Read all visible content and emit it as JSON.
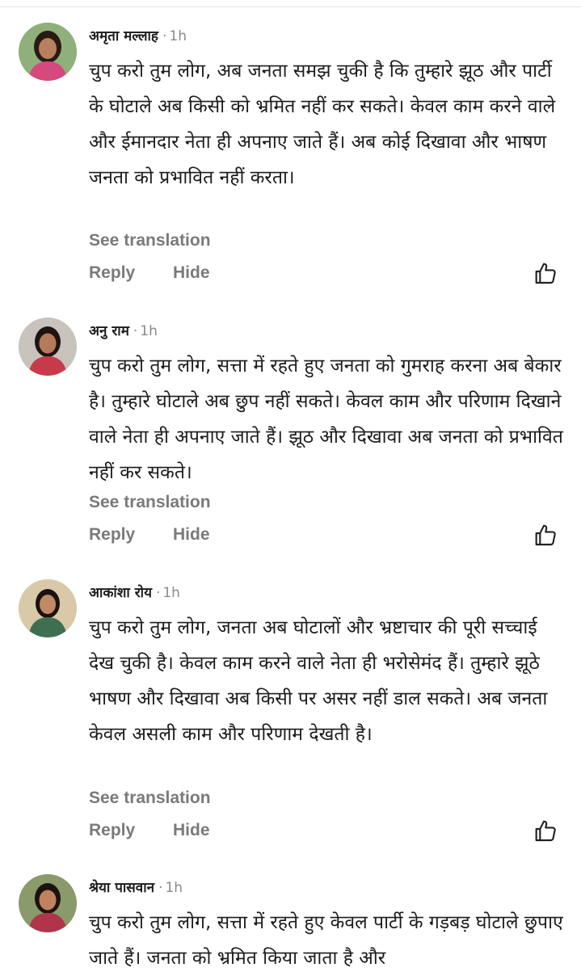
{
  "comments": [
    {
      "author": "अमृता मल्लाह",
      "separator": "·",
      "time": "1h",
      "text": "चुप करो तुम लोग, अब जनता समझ चुकी है कि तुम्हारे झूठ और पार्टी के घोटाले अब किसी को भ्रमित नहीं कर सकते। केवल काम करने वाले और ईमानदार नेता ही अपनाए जाते हैं। अब कोई दिखावा और भाषण जनता को प्रभावित नहीं करता।",
      "see_translation": "See translation",
      "reply": "Reply",
      "hide": "Hide",
      "like_icon": "thumbs-up-outline",
      "avatar_colors": {
        "bg": "#8fb07a",
        "hair": "#2a1a14",
        "skin": "#b8805e",
        "cloth": "#d6497e"
      }
    },
    {
      "author": "अनु राम",
      "separator": "·",
      "time": "1h",
      "text": "चुप करो तुम लोग, सत्ता में रहते हुए जनता को गुमराह करना अब बेकार है। तुम्हारे घोटाले अब छुप नहीं सकते। केवल काम और परिणाम दिखाने वाले नेता ही अपनाए जाते हैं। झूठ और दिखावा अब जनता को प्रभावित नहीं कर सकते।",
      "see_translation": "See translation",
      "reply": "Reply",
      "hide": "Hide",
      "like_icon": "thumbs-up-outline",
      "avatar_colors": {
        "bg": "#c9c3bd",
        "hair": "#1e1412",
        "skin": "#b57a5a",
        "cloth": "#c73a4a"
      }
    },
    {
      "author": "आकांशा रोय",
      "separator": "·",
      "time": "1h",
      "text": "चुप करो तुम लोग, जनता अब घोटालों और भ्रष्टाचार की पूरी सच्चाई देख चुकी है। केवल काम करने वाले नेता ही भरोसेमंद हैं। तुम्हारे झूठे भाषण और दिखावा अब किसी पर असर नहीं डाल सकते। अब जनता केवल असली काम और परिणाम देखती है।",
      "see_translation": "See translation",
      "reply": "Reply",
      "hide": "Hide",
      "like_icon": "thumbs-up-outline",
      "avatar_colors": {
        "bg": "#d9c9a8",
        "hair": "#1b120e",
        "skin": "#c08a66",
        "cloth": "#3f6f52"
      }
    },
    {
      "author": "श्रेया पासवान",
      "separator": "·",
      "time": "1h",
      "text": "चुप करो तुम लोग, सत्ता में रहते हुए केवल पार्टी के गड़बड़ घोटाले छुपाए जाते हैं। जनता को भ्रमित किया जाता है और",
      "avatar_colors": {
        "bg": "#8a9a6a",
        "hair": "#1c130f",
        "skin": "#c0825e",
        "cloth": "#b0344a"
      }
    }
  ]
}
